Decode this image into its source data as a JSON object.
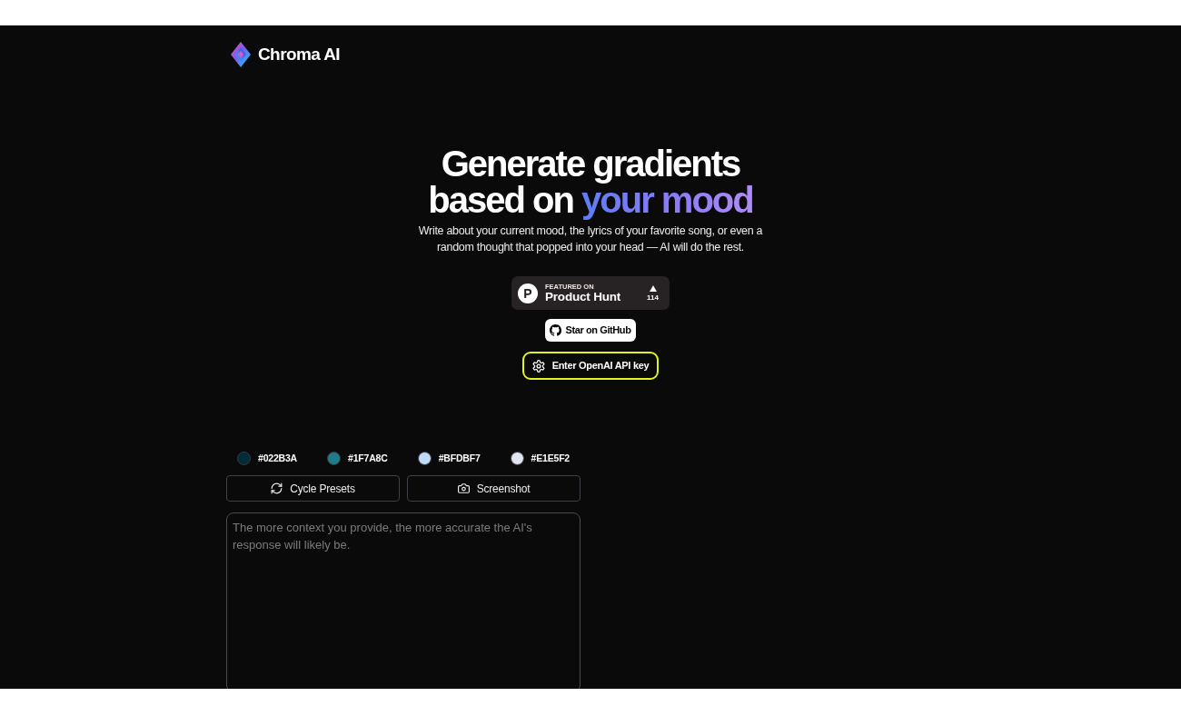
{
  "brand": {
    "name": "Chroma AI"
  },
  "hero": {
    "heading": [
      {
        "text": "Generate gradients based on",
        "kind": "plain"
      },
      {
        "text": "your mood",
        "kind": "accent"
      }
    ],
    "subtitle": "Write about your current mood, the lyrics of your favorite song, or even a random thought that popped into your head — AI will do the rest."
  },
  "product_hunt_badge": {
    "logo_letter": "P",
    "eyebrow": "FEATURED ON",
    "name": "Product Hunt",
    "votes": "114"
  },
  "github_button": {
    "label": "Star on GitHub"
  },
  "api_key_button": {
    "label": "Enter OpenAI API key"
  },
  "palette": [
    {
      "label": "#022B3A",
      "color": "#022b3a"
    },
    {
      "label": "#1F7A8C",
      "color": "#1f7a8c"
    },
    {
      "label": "#BFDBF7",
      "color": "#bfdbf7"
    },
    {
      "label": "#E1E5F2",
      "color": "#e1e5f2"
    }
  ],
  "actions": [
    {
      "label": "Cycle Presets",
      "kind": "cycle"
    },
    {
      "label": "Screenshot",
      "kind": "screenshot"
    }
  ],
  "prompt": {
    "placeholder": "The more context you provide, the more accurate the AI's response will likely be."
  }
}
